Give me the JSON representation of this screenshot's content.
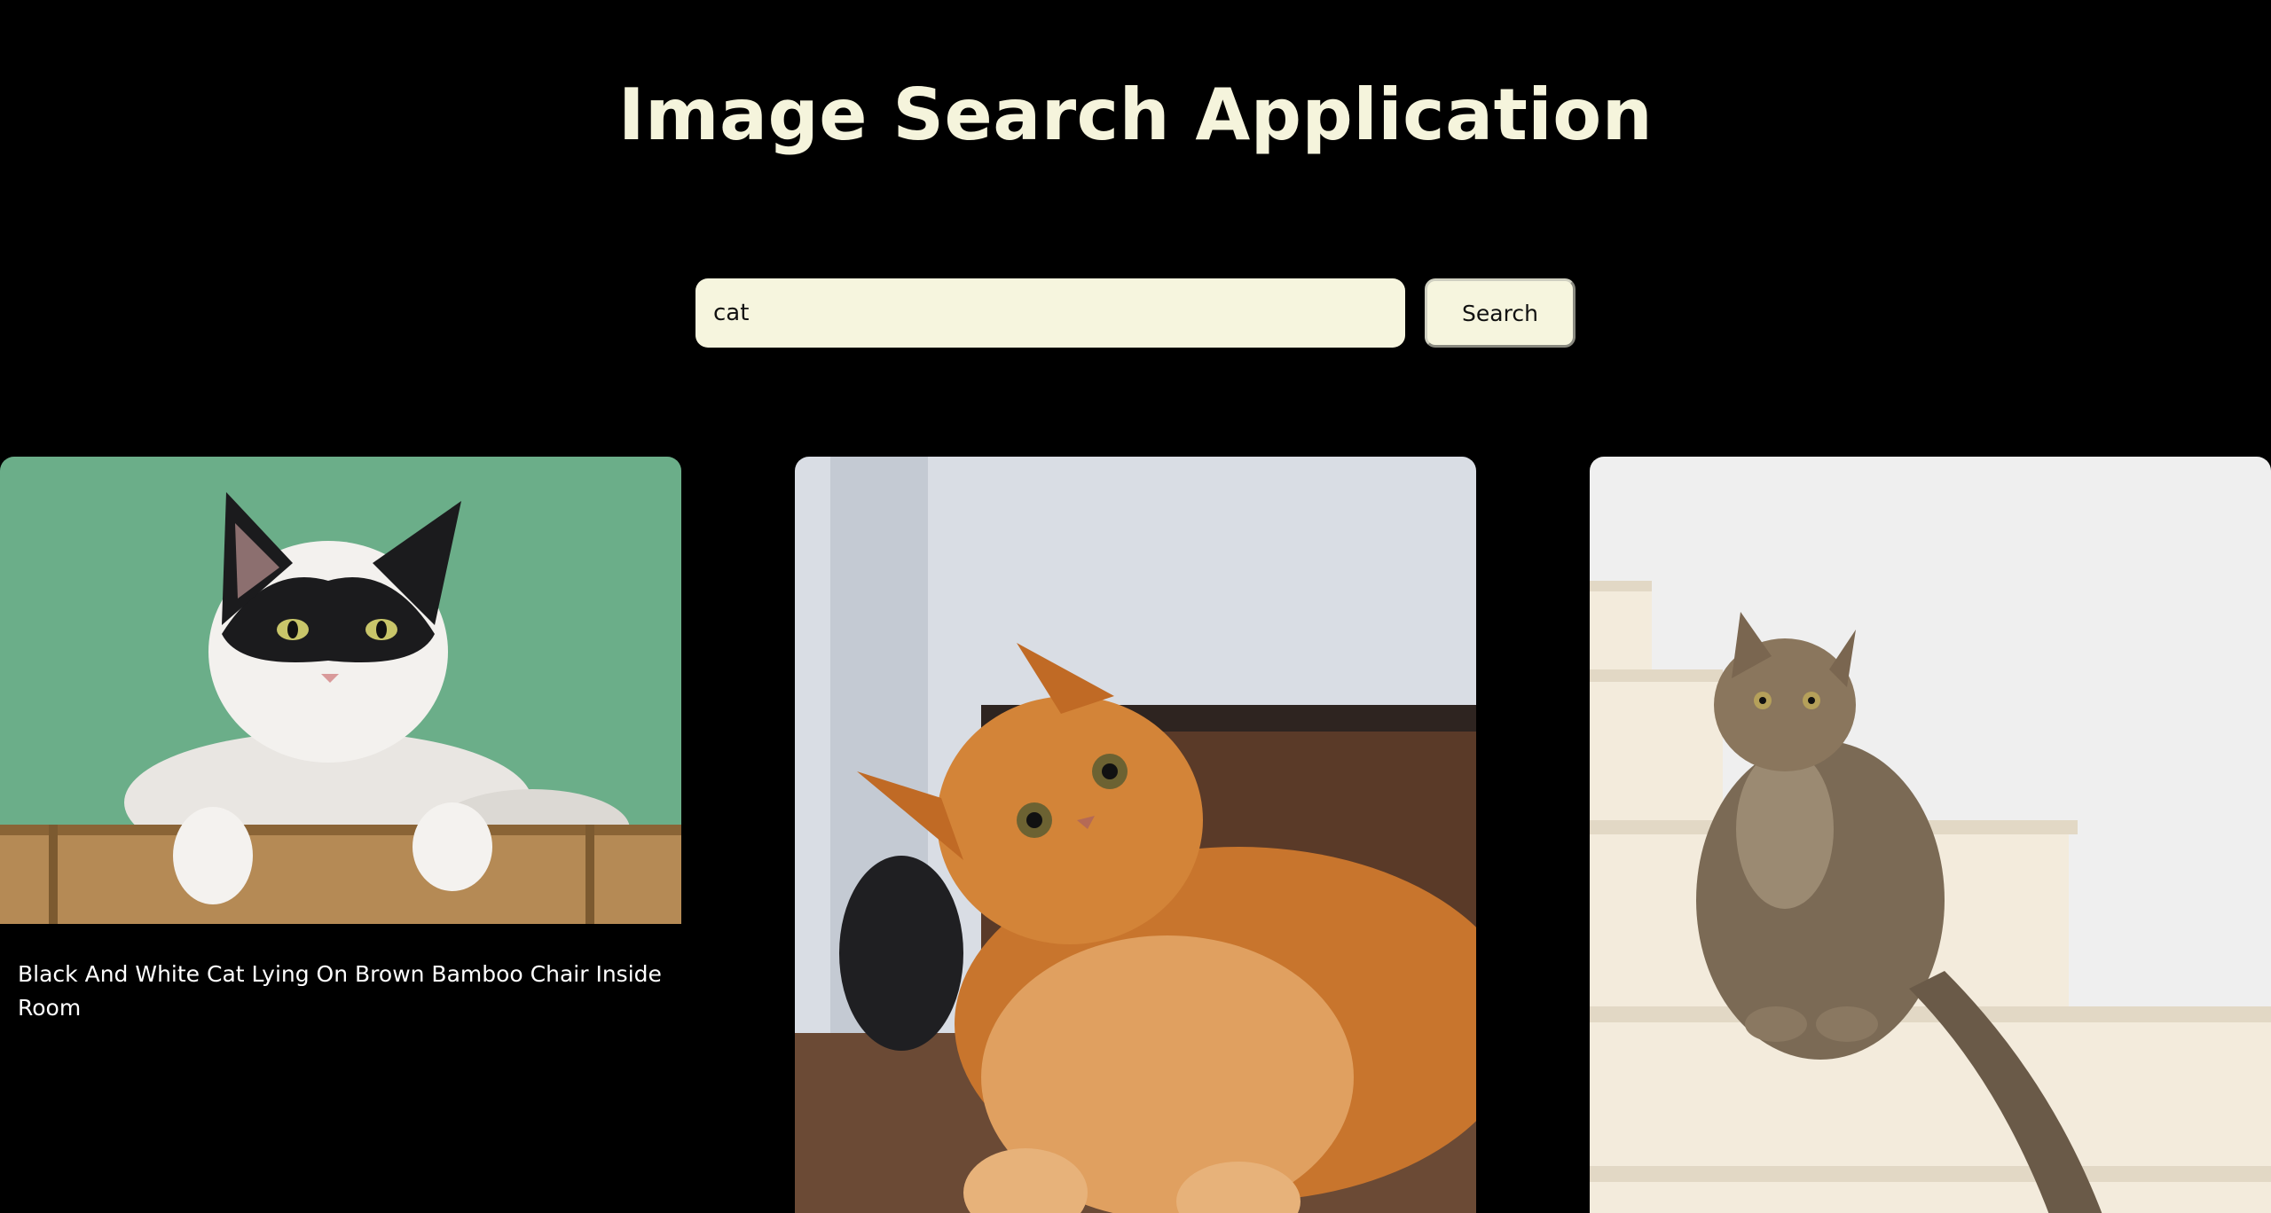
{
  "app": {
    "title": "Image Search Application"
  },
  "search": {
    "value": "cat",
    "button_label": "Search"
  },
  "results": [
    {
      "caption": "Black And White Cat Lying On Brown Bamboo Chair Inside Room"
    },
    {
      "caption": ""
    },
    {
      "caption": ""
    }
  ],
  "colors": {
    "background": "#000000",
    "title": "#f5f4dc",
    "input_background": "#f6f5de",
    "caption_text": "#ffffff"
  }
}
